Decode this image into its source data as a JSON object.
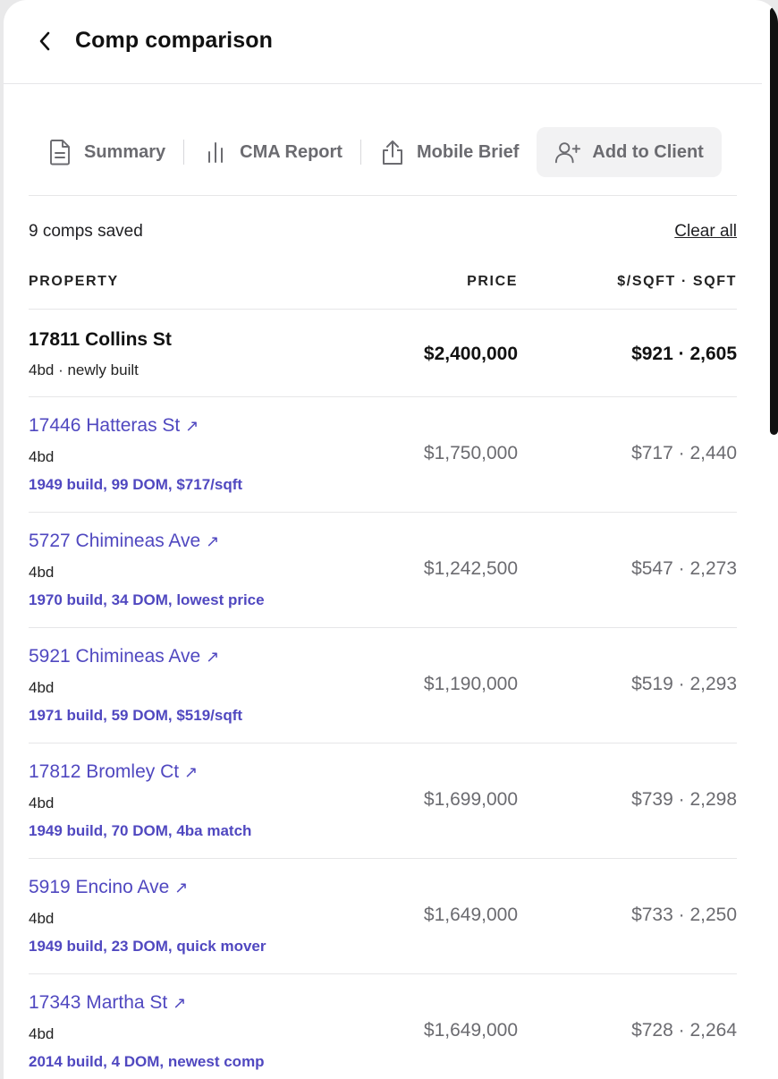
{
  "header": {
    "title": "Comp comparison"
  },
  "tabs": [
    {
      "label": "Summary",
      "icon": "document-icon"
    },
    {
      "label": "CMA Report",
      "icon": "bar-chart-icon"
    },
    {
      "label": "Mobile Brief",
      "icon": "share-icon"
    },
    {
      "label": "Add to Client",
      "icon": "add-user-icon"
    }
  ],
  "summary": {
    "count_text": "9 comps saved",
    "clear_label": "Clear all"
  },
  "columns": {
    "property": "PROPERTY",
    "price": "PRICE",
    "ppsf": "$/SQFT · SQFT"
  },
  "subject": {
    "address": "17811 Collins St",
    "details": "4bd · newly built",
    "price": "$2,400,000",
    "ppsf": "$921 · 2,605"
  },
  "comps": [
    {
      "address": "17446 Hatteras St",
      "beds": "4bd",
      "note": "1949 build, 99 DOM, $717/sqft",
      "price": "$1,750,000",
      "ppsf": "$717 · 2,440"
    },
    {
      "address": "5727 Chimineas Ave",
      "beds": "4bd",
      "note": "1970 build, 34 DOM, lowest price",
      "price": "$1,242,500",
      "ppsf": "$547 · 2,273"
    },
    {
      "address": "5921 Chimineas Ave",
      "beds": "4bd",
      "note": "1971 build, 59 DOM, $519/sqft",
      "price": "$1,190,000",
      "ppsf": "$519 · 2,293"
    },
    {
      "address": "17812 Bromley Ct",
      "beds": "4bd",
      "note": "1949 build, 70 DOM, 4ba match",
      "price": "$1,699,000",
      "ppsf": "$739 · 2,298"
    },
    {
      "address": "5919 Encino Ave",
      "beds": "4bd",
      "note": "1949 build, 23 DOM, quick mover",
      "price": "$1,649,000",
      "ppsf": "$733 · 2,250"
    },
    {
      "address": "17343 Martha St",
      "beds": "4bd",
      "note": "2014 build, 4 DOM, newest comp",
      "price": "$1,649,000",
      "ppsf": "$728 · 2,264"
    }
  ],
  "colors": {
    "link": "#5048c0",
    "muted": "#6b6b70",
    "active_tab_bg": "#f2f2f3"
  }
}
